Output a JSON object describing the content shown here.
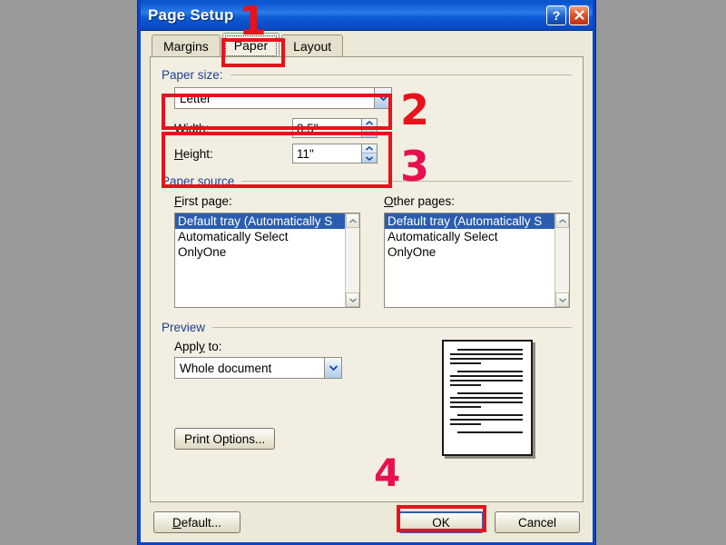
{
  "window": {
    "title": "Page Setup",
    "help_button": "?",
    "close_button": "✕"
  },
  "tabs": [
    {
      "label": "Margins",
      "active": false
    },
    {
      "label": "Paper",
      "active": true
    },
    {
      "label": "Layout",
      "active": false
    }
  ],
  "paper_size": {
    "group_label": "Paper size:",
    "selected": "Letter",
    "width_label": "Width:",
    "width_value": "8.5\"",
    "height_label": "Height:",
    "height_value": "11\""
  },
  "paper_source": {
    "group_label": "Paper source",
    "first_page_label": "First page:",
    "other_pages_label": "Other pages:",
    "first_page_items": [
      "Default tray (Automatically S",
      "Automatically Select",
      "OnlyOne"
    ],
    "first_page_selected_index": 0,
    "other_pages_items": [
      "Default tray (Automatically S",
      "Automatically Select",
      "OnlyOne"
    ],
    "other_pages_selected_index": 0
  },
  "preview": {
    "group_label": "Preview",
    "apply_to_label": "Apply to:",
    "apply_to_value": "Whole document",
    "print_options_label": "Print Options..."
  },
  "footer": {
    "default_label": "Default...",
    "ok_label": "OK",
    "cancel_label": "Cancel"
  },
  "annotations": [
    {
      "number": "1",
      "color": "#e8121d"
    },
    {
      "number": "2",
      "color": "#e8121d"
    },
    {
      "number": "3",
      "color": "#e81050"
    },
    {
      "number": "4",
      "color": "#e81050"
    }
  ],
  "colors": {
    "page_background": "#999999",
    "dialog_face": "#ece9d8",
    "panel_face": "#f2efe2",
    "titlebar_blue": "#0b55cf",
    "group_label_blue": "#1f3e8c",
    "selection_blue": "#2a5db0",
    "annotation_red": "#e8121d",
    "annotation_crimson": "#e81050"
  }
}
